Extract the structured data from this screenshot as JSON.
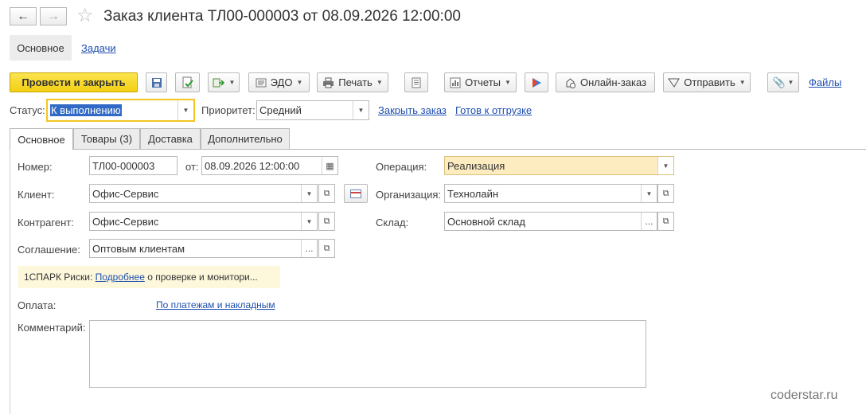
{
  "window": {
    "title": "Заказ клиента ТЛ00-000003 от 08.09.2026 12:00:00"
  },
  "section_tabs": {
    "main": "Основное",
    "tasks": "Задачи"
  },
  "toolbar": {
    "post_close": "Провести и закрыть",
    "edo": "ЭДО",
    "print": "Печать",
    "reports": "Отчеты",
    "online_order": "Онлайн-заказ",
    "send": "Отправить",
    "files": "Файлы"
  },
  "status_bar": {
    "status_label": "Статус:",
    "status_value": "К выполнению",
    "priority_label": "Приоритет:",
    "priority_value": "Средний",
    "close_order": "Закрыть заказ",
    "ready_shipment": "Готов к отгрузке"
  },
  "page_tabs": [
    {
      "label": "Основное"
    },
    {
      "label": "Товары (3)"
    },
    {
      "label": "Доставка"
    },
    {
      "label": "Дополнительно"
    }
  ],
  "form": {
    "number_label": "Номер:",
    "number_value": "ТЛ00-000003",
    "from_label": "от:",
    "date_value": "08.09.2026 12:00:00",
    "client_label": "Клиент:",
    "client_value": "Офис-Сервис",
    "contractor_label": "Контрагент:",
    "contractor_value": "Офис-Сервис",
    "agreement_label": "Соглашение:",
    "agreement_value": "Оптовым клиентам",
    "operation_label": "Операция:",
    "operation_value": "Реализация",
    "organization_label": "Организация:",
    "organization_value": "Технолайн",
    "warehouse_label": "Склад:",
    "warehouse_value": "Основной склад",
    "spark_prefix": "1СПАРК Риски:",
    "spark_link": "Подробнее",
    "spark_suffix": "о проверке и монитори...",
    "payment_label": "Оплата:",
    "payment_link": "По платежам и накладным",
    "comment_label": "Комментарий:"
  },
  "watermark": "coderstar.ru",
  "colors": {
    "primary_button": "#f3cf14",
    "link": "#1f4fb0",
    "status_focus": "#f1c623",
    "selection": "#3169c6",
    "operation_bg": "#fdecc0",
    "spark_bg": "#fdf8dc"
  }
}
